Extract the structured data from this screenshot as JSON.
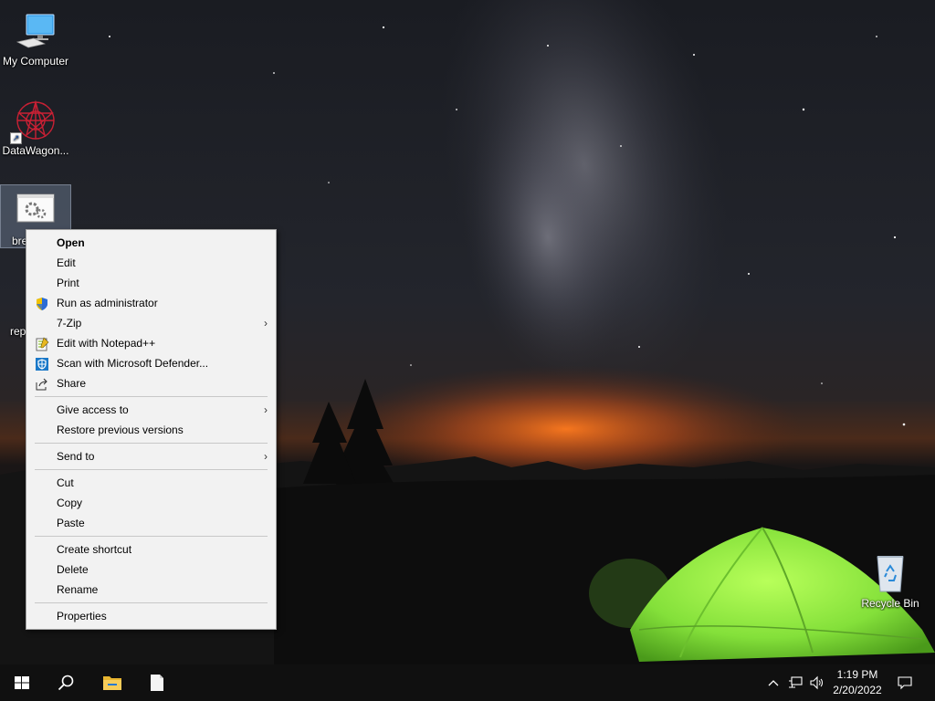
{
  "desktop": {
    "icons": [
      {
        "label": "My Computer"
      },
      {
        "label": "DataWagon..."
      },
      {
        "label": "bre"
      },
      {
        "label": "rep"
      },
      {
        "label": "Recycle Bin"
      }
    ]
  },
  "context_menu": {
    "items": {
      "open": "Open",
      "edit": "Edit",
      "print": "Print",
      "run_as_admin": "Run as administrator",
      "seven_zip": "7-Zip",
      "edit_notepad": "Edit with Notepad++",
      "scan_defender": "Scan with Microsoft Defender...",
      "share": "Share",
      "give_access": "Give access to",
      "restore_versions": "Restore previous versions",
      "send_to": "Send to",
      "cut": "Cut",
      "copy": "Copy",
      "paste": "Paste",
      "create_shortcut": "Create shortcut",
      "delete": "Delete",
      "rename": "Rename",
      "properties": "Properties"
    },
    "submenu_arrow": "›"
  },
  "taskbar": {
    "time": "1:19 PM",
    "date": "2/20/2022",
    "icons": [
      "start-icon",
      "search-icon",
      "file-explorer-icon",
      "document-icon"
    ],
    "tray_icons": [
      "chevron-up-icon",
      "network-icon",
      "volume-icon",
      "notification-icon"
    ]
  },
  "colors": {
    "taskbar_bg": "#101010",
    "menu_bg": "#f2f2f2",
    "tent_green": "#8fe83a",
    "horizon_orange": "#e8681c"
  }
}
